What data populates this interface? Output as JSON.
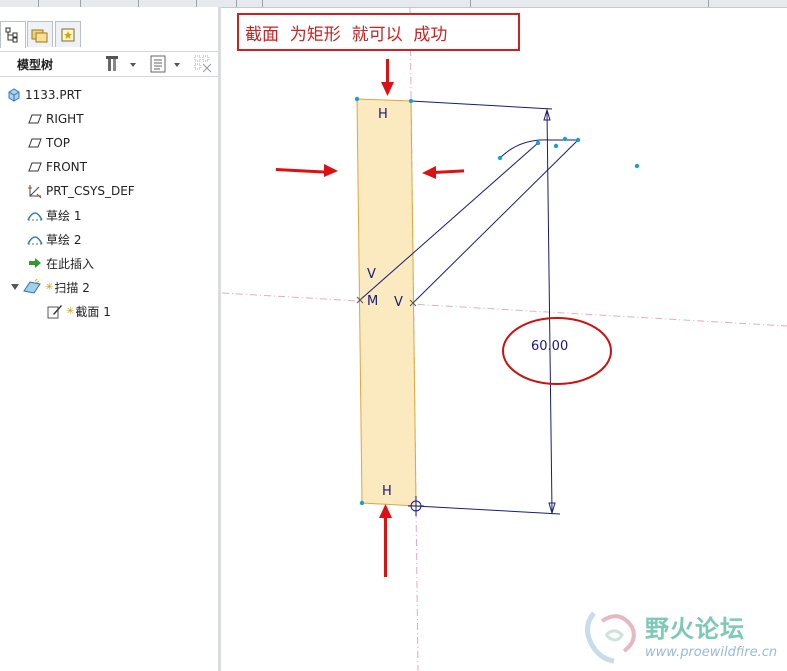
{
  "model_tree": {
    "title": "模型树",
    "items": [
      {
        "label": "1133.PRT",
        "icon": "part-icon"
      },
      {
        "label": "RIGHT",
        "icon": "datum-plane-icon"
      },
      {
        "label": "TOP",
        "icon": "datum-plane-icon"
      },
      {
        "label": "FRONT",
        "icon": "datum-plane-icon"
      },
      {
        "label": "PRT_CSYS_DEF",
        "icon": "csys-icon"
      },
      {
        "label": "草绘 1",
        "icon": "sketch-icon"
      },
      {
        "label": "草绘 2",
        "icon": "sketch-icon"
      },
      {
        "label": "在此插入",
        "icon": "insert-here-arrow-icon"
      },
      {
        "label": "扫描 2",
        "icon": "sweep-icon"
      },
      {
        "label": "截面 1",
        "icon": "section-sketch-icon"
      }
    ]
  },
  "annotation": {
    "text": "截面  为矩形  就可以  成功",
    "color": "#cc2222"
  },
  "sketch": {
    "dimension": "60.00",
    "constraint_h_top": "H",
    "constraint_h_bottom": "H",
    "constraint_v_left": "V",
    "constraint_m": "M",
    "constraint_v_right": "V",
    "section_fill": "#fbe9bf",
    "section_border": "#e0a640",
    "line_color": "#1a1a7a",
    "arrow_color": "#dd1111"
  },
  "watermark": {
    "name": "野火论坛",
    "url": "www.proewildfire.cn"
  }
}
